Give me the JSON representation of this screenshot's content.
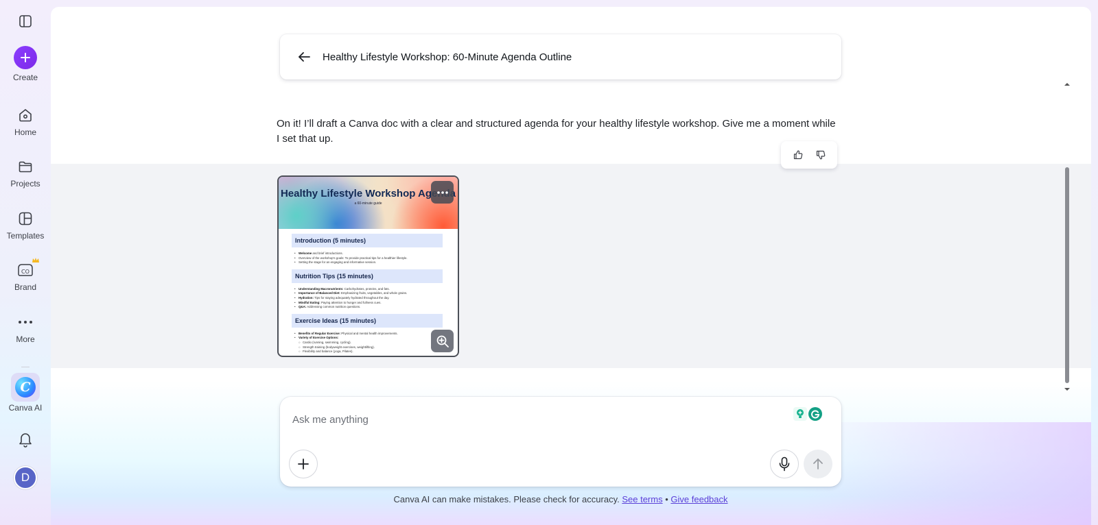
{
  "sidebar": {
    "toggle_icon": "sidebar-panel-icon",
    "create_label": "Create",
    "items": [
      {
        "label": "Home",
        "icon": "home-icon"
      },
      {
        "label": "Projects",
        "icon": "folder-icon"
      },
      {
        "label": "Templates",
        "icon": "templates-icon"
      },
      {
        "label": "Brand",
        "icon": "brand-icon"
      },
      {
        "label": "More",
        "icon": "more-icon"
      },
      {
        "label": "Canva AI",
        "icon": "canva-ai-icon"
      }
    ],
    "canva_ai_glyph": "C",
    "notifications_icon": "bell-icon",
    "avatar_initial": "D"
  },
  "header": {
    "title": "Healthy Lifestyle Workshop: 60-Minute Agenda Outline"
  },
  "message": {
    "text": "On it! I’ll draft a Canva doc with a clear and structured agenda for your healthy lifestyle workshop. Give me a moment while I set that up."
  },
  "document_preview": {
    "title": "Healthy Lifestyle Workshop Agenda",
    "subtitle": "a 60-minute guide",
    "sections": [
      {
        "heading": "Introduction (5 minutes)",
        "items": [
          {
            "bold": "Welcome",
            "text": " and brief introductions."
          },
          {
            "bold": "",
            "text": "Overview of the workshop's goals: To provide practical tips for a healthier lifestyle."
          },
          {
            "bold": "",
            "text": "Setting the stage for an engaging and informative session."
          }
        ]
      },
      {
        "heading": "Nutrition Tips (15 minutes)",
        "items": [
          {
            "bold": "Understanding Macronutrients:",
            "text": " Carbohydrates, proteins, and fats."
          },
          {
            "bold": "Importance of Balanced Diet:",
            "text": " Emphasizing fruits, vegetables, and whole grains."
          },
          {
            "bold": "Hydration:",
            "text": " Tips for staying adequately hydrated throughout the day."
          },
          {
            "bold": "Mindful Eating:",
            "text": " Paying attention to hunger and fullness cues."
          },
          {
            "bold": "Q&A:",
            "text": " Addressing common nutrition questions."
          }
        ]
      },
      {
        "heading": "Exercise Ideas (15 minutes)",
        "items": [
          {
            "bold": "Benefits of Regular Exercise:",
            "text": " Physical and mental health improvements."
          },
          {
            "bold": "Variety of Exercise Options:",
            "text": ""
          }
        ],
        "subitems": [
          "Cardio (running, swimming, cycling).",
          "Strength training (bodyweight exercises, weightlifting).",
          "Flexibility and balance (yoga, Pilates)."
        ]
      }
    ]
  },
  "composer": {
    "placeholder": "Ask me anything",
    "value": ""
  },
  "footer": {
    "note": "Canva AI can make mistakes. Please check for accuracy.",
    "terms_link": "See terms",
    "separator": "•",
    "feedback_link": "Give feedback"
  },
  "colors": {
    "accent": "#8b3dff",
    "link": "#5a3fd8"
  }
}
